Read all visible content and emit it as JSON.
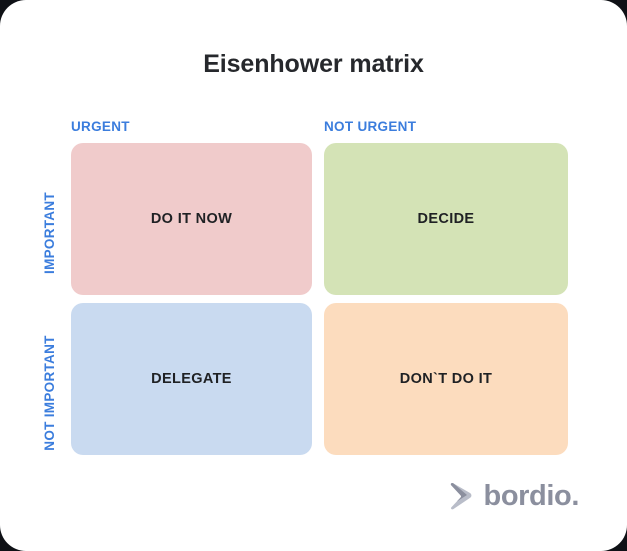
{
  "card": {
    "title": "Eisenhower matrix",
    "accent_color": "#3b7ddd",
    "title_color": "#26282c",
    "background_color": "#ffffff"
  },
  "axes": {
    "columns": [
      {
        "label": "URGENT"
      },
      {
        "label": "NOT URGENT"
      }
    ],
    "rows": [
      {
        "label": "IMPORTANT"
      },
      {
        "label": "NOT IMPORTANT"
      }
    ]
  },
  "quadrants": [
    {
      "label": "DO IT NOW",
      "row": "IMPORTANT",
      "column": "URGENT",
      "color": "#f0cbcb"
    },
    {
      "label": "DECIDE",
      "row": "IMPORTANT",
      "column": "NOT URGENT",
      "color": "#d4e3b6"
    },
    {
      "label": "DELEGATE",
      "row": "NOT IMPORTANT",
      "column": "URGENT",
      "color": "#c9daf0"
    },
    {
      "label": "DON`T DO IT",
      "row": "NOT IMPORTANT",
      "column": "NOT URGENT",
      "color": "#fcdcbe"
    }
  ],
  "logo": {
    "text": "bordio.",
    "mark": "chevron-arrow-icon",
    "color": "#8b8f9e"
  }
}
